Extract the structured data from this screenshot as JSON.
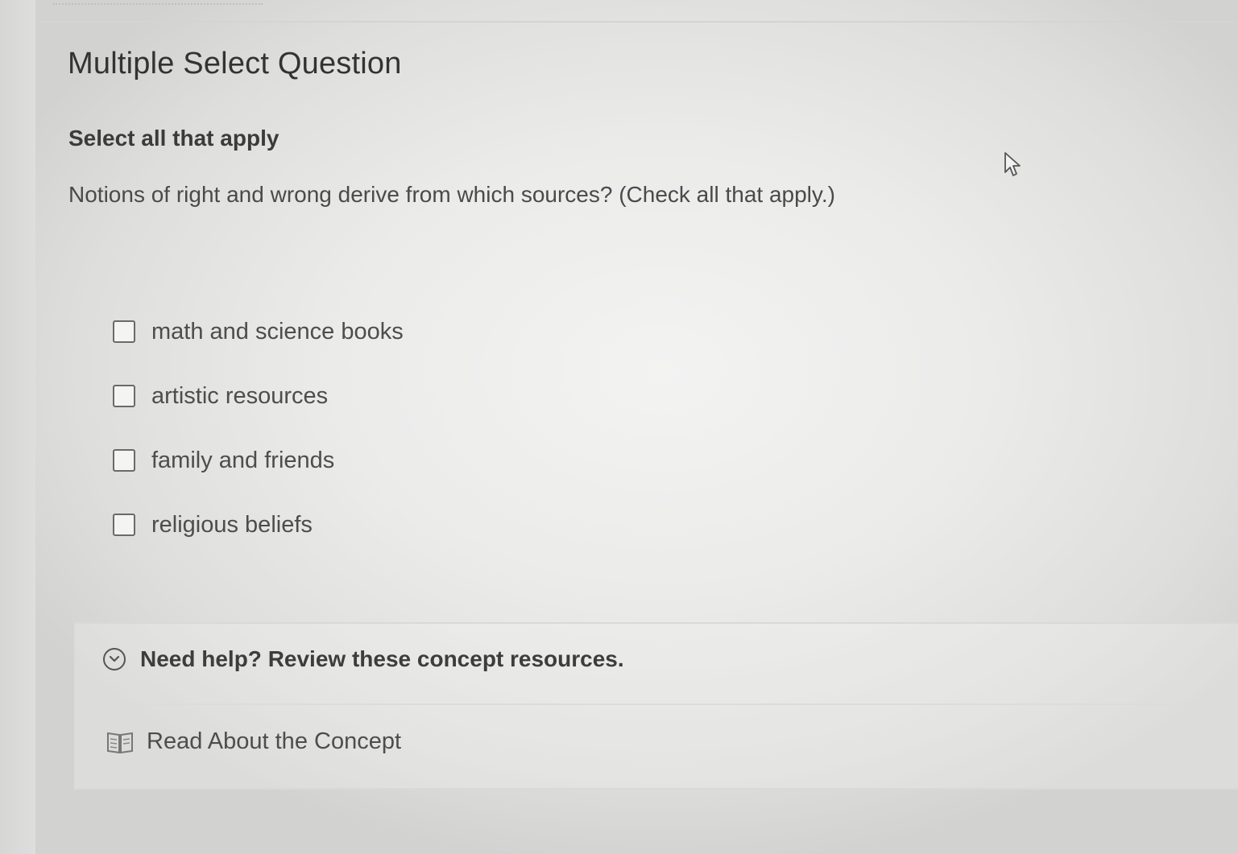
{
  "question": {
    "type_title": "Multiple Select Question",
    "instruction": "Select all that apply",
    "prompt": "Notions of right and wrong derive from which sources? (Check all that apply.)",
    "options": [
      {
        "label": "math and science books",
        "checked": false
      },
      {
        "label": "artistic resources",
        "checked": false
      },
      {
        "label": "family and friends",
        "checked": false
      },
      {
        "label": "religious beliefs",
        "checked": false
      }
    ]
  },
  "help": {
    "title": "Need help? Review these concept resources.",
    "expander_icon": "chevron-down-circle-icon",
    "resources": [
      {
        "label": "Read About the Concept",
        "icon": "book-icon"
      }
    ]
  },
  "colors": {
    "text_primary": "#333333",
    "text_secondary": "#4d4d4d",
    "border": "#d9d9d8"
  }
}
